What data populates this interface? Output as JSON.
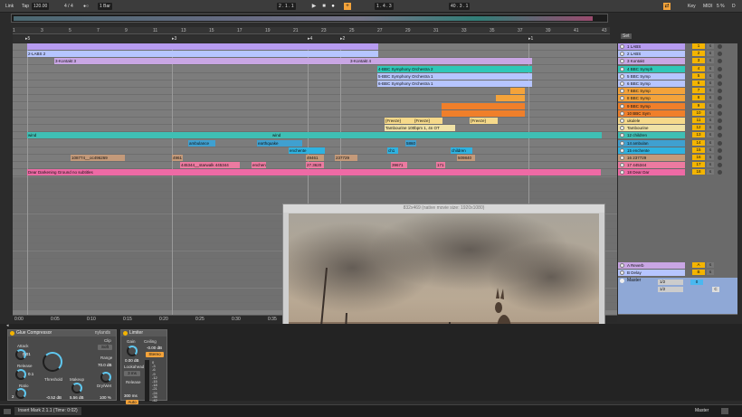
{
  "transport": {
    "link": "Link",
    "tap": "Tap",
    "tempo": "120.00",
    "signature": "4 / 4",
    "metronome": "●○",
    "quant": "1 Bar",
    "position": "2 . 1 . 1",
    "punch_in": "1 . 4 . 3",
    "loop_len": "40 . 3 . 1",
    "key": "Key",
    "midi": "MIDI",
    "cpu": "5 %",
    "d": "D"
  },
  "ruler": {
    "bars": [
      "1",
      "3",
      "5",
      "7",
      "9",
      "11",
      "13",
      "15",
      "17",
      "19",
      "21",
      "23",
      "25",
      "27",
      "29",
      "31",
      "33",
      "35",
      "37",
      "39",
      "41",
      "43"
    ],
    "locators": [
      "1 5",
      "1 3",
      "1 4",
      "1 2",
      "1 1"
    ]
  },
  "timeline": [
    "0:00",
    "0:05",
    "0:10",
    "0:15",
    "0:20",
    "0:25",
    "0:30",
    "0:35"
  ],
  "clips": [
    {
      "lane": 0,
      "label": "",
      "color": "#b79cf0",
      "start": 16,
      "width": 388
    },
    {
      "lane": 1,
      "label": "2-LABS 2",
      "color": "#b6c5ff",
      "start": 16,
      "width": 388
    },
    {
      "lane": 2,
      "label": "3-Kontakt 3",
      "color": "#c9a6e4",
      "start": 46,
      "width": 326
    },
    {
      "lane": 2,
      "label": "3-Kontakt 4",
      "color": "#c9a6e4",
      "start": 372,
      "width": 202
    },
    {
      "lane": 3,
      "label": "4-BBC Symphony Orchestra 2",
      "color": "#2fc8b8",
      "start": 403,
      "width": 171
    },
    {
      "lane": 4,
      "label": "5-BBC Symphony Orchestra 1",
      "color": "#b6c5ff",
      "start": 403,
      "width": 171
    },
    {
      "lane": 5,
      "label": "6-BBC Symphony Orchestra 1",
      "color": "#b6c5ff",
      "start": 403,
      "width": 171
    },
    {
      "lane": 6,
      "label": "",
      "color": "#f4a33a",
      "start": 550,
      "width": 16
    },
    {
      "lane": 7,
      "label": "",
      "color": "#f4a33a",
      "start": 534,
      "width": 32
    },
    {
      "lane": 8,
      "label": "",
      "color": "#f07f2a",
      "start": 474,
      "width": 92
    },
    {
      "lane": 9,
      "label": "",
      "color": "#f07f2a",
      "start": 474,
      "width": 92
    },
    {
      "lane": 10,
      "label": "{Freeze}",
      "color": "#f6d98a",
      "start": 411,
      "width": 32
    },
    {
      "lane": 10,
      "label": "{Freeze}",
      "color": "#f6d98a",
      "start": 443,
      "width": 32
    },
    {
      "lane": 10,
      "label": "{Freeze}",
      "color": "#f6d98a",
      "start": 505,
      "width": 31
    },
    {
      "lane": 11,
      "label": "Tambourine 100bpm 1, 4n OT",
      "color": "#f0e2a6",
      "start": 411,
      "width": 78
    },
    {
      "lane": 12,
      "label": "wind",
      "color": "#3fbfb4",
      "start": 16,
      "width": 270
    },
    {
      "lane": 12,
      "label": "wind",
      "color": "#3fbfb4",
      "start": 286,
      "width": 365
    },
    {
      "lane": 13,
      "label": "ambulance",
      "color": "#3fa0d0",
      "start": 194,
      "width": 30
    },
    {
      "lane": 13,
      "label": "earthquake",
      "color": "#3fa0d0",
      "start": 270,
      "width": 50
    },
    {
      "lane": 13,
      "label": "5860",
      "color": "#3fa0d0",
      "start": 434,
      "width": 12
    },
    {
      "lane": 14,
      "label": "enchente",
      "color": "#2fb2e0",
      "start": 305,
      "width": 40
    },
    {
      "lane": 14,
      "label": "ch1",
      "color": "#2fb2e0",
      "start": 414,
      "width": 12
    },
    {
      "lane": 14,
      "label": "children",
      "color": "#2fb2e0",
      "start": 484,
      "width": 24
    },
    {
      "lane": 15,
      "label": "108774__oc496269",
      "color": "#c49a7a",
      "start": 64,
      "width": 60
    },
    {
      "lane": 15,
      "label": "4961",
      "color": "#c49a7a",
      "start": 176,
      "width": 12
    },
    {
      "lane": 15,
      "label": "49461",
      "color": "#c49a7a",
      "start": 324,
      "width": 20
    },
    {
      "lane": 15,
      "label": "237729",
      "color": "#c49a7a",
      "start": 356,
      "width": 25
    },
    {
      "lane": 15,
      "label": "509840",
      "color": "#c49a7a",
      "start": 491,
      "width": 20
    },
    {
      "lane": 16,
      "label": "445344__starwalk 445344",
      "color": "#ec7aa0",
      "start": 185,
      "width": 66
    },
    {
      "lane": 16,
      "label": "enchen",
      "color": "#ec7aa0",
      "start": 264,
      "width": 16
    },
    {
      "lane": 16,
      "label": "27.3620",
      "color": "#ec7aa0",
      "start": 324,
      "width": 20
    },
    {
      "lane": 16,
      "label": "39671",
      "color": "#ec7aa0",
      "start": 418,
      "width": 18
    },
    {
      "lane": 16,
      "label": "171",
      "color": "#ec7aa0",
      "start": 468,
      "width": 10
    },
    {
      "lane": 17,
      "label": "Dear Darkening Ground no subtitles",
      "color": "#ee6aa5",
      "start": 16,
      "width": 634
    }
  ],
  "tracks": [
    {
      "name": "1 LABS",
      "num": "1",
      "color": "#b79cf0"
    },
    {
      "name": "2 LABS",
      "num": "2",
      "color": "#b6c5ff"
    },
    {
      "name": "3 Kontakt",
      "num": "3",
      "color": "#c9a6e4"
    },
    {
      "name": "4 BBC Symph",
      "num": "4",
      "color": "#2fc8b8"
    },
    {
      "name": "5 BBC Symp",
      "num": "5",
      "color": "#b6c5ff"
    },
    {
      "name": "6 BBC Symp",
      "num": "6",
      "color": "#b6c5ff"
    },
    {
      "name": "7 BBC Symp",
      "num": "7",
      "color": "#f4a33a"
    },
    {
      "name": "8 BBC Symp",
      "num": "8",
      "color": "#f4a33a"
    },
    {
      "name": "9 BBC Symp",
      "num": "9",
      "color": "#f07f2a"
    },
    {
      "name": "10 BBC Sym",
      "num": "10",
      "color": "#f07f2a"
    },
    {
      "name": "ukulele",
      "num": "11",
      "color": "#f6d98a"
    },
    {
      "name": "Tambourine",
      "num": "12",
      "color": "#f0e2a6"
    },
    {
      "name": "12 children",
      "num": "13",
      "color": "#3fbfb4"
    },
    {
      "name": "14 ambulan",
      "num": "14",
      "color": "#3fa0d0"
    },
    {
      "name": "15 enchente",
      "num": "15",
      "color": "#2fb2e0"
    },
    {
      "name": "16 237729",
      "num": "16",
      "color": "#c49a7a"
    },
    {
      "name": "17 445344",
      "num": "17",
      "color": "#ec7aa0"
    },
    {
      "name": "18 Dear Dar",
      "num": "18",
      "color": "#ee6aa5"
    }
  ],
  "returns": [
    {
      "name": "A Reverb",
      "num": "A",
      "color": "#c9a6e4"
    },
    {
      "name": "B Delay",
      "num": "B",
      "color": "#b6c5ff"
    }
  ],
  "master": {
    "name": "Master",
    "sel1": "1/2",
    "sel2": "1/2",
    "val": "0",
    "c": "C"
  },
  "movie": {
    "title": "832x469 (native movie size: 1920x1080)"
  },
  "compressor": {
    "title": "Glue Compressor",
    "preset": "nylands",
    "attack": "Attack",
    "attack_val": "0.01",
    "release": "Release",
    "release_val": "0.1",
    "ratio": "Ratio",
    "ratio_val": "2",
    "threshold": "Threshold",
    "threshold_val": "-0.52 dB",
    "makeup": "Makeup",
    "makeup_val": "5.56 dB",
    "clip": "Clip",
    "soft": "Soft",
    "range": "Range",
    "range_val": "70.0 dB",
    "drywet": "Dry/Wet",
    "drywet_val": "100 %"
  },
  "limiter": {
    "title": "Limiter",
    "gain": "Gain",
    "gain_val": "0.00 dB",
    "ceiling": "Ceiling",
    "ceiling_val": "-0.00 dB",
    "stereo": "Stereo",
    "lookahead": "Lookahead",
    "lookahead_val": "3 ms",
    "release": "Release",
    "release_val": "300 ms",
    "auto": "Auto",
    "scale": [
      "0",
      "-3",
      "-6",
      "-9",
      "-12",
      "-15",
      "-18",
      "-21",
      "-24",
      "-36",
      "-42"
    ]
  },
  "status": {
    "text": "Insert Mark 2.1.1 (Time: 0:02)",
    "master": "Master"
  },
  "set_label": "Set"
}
